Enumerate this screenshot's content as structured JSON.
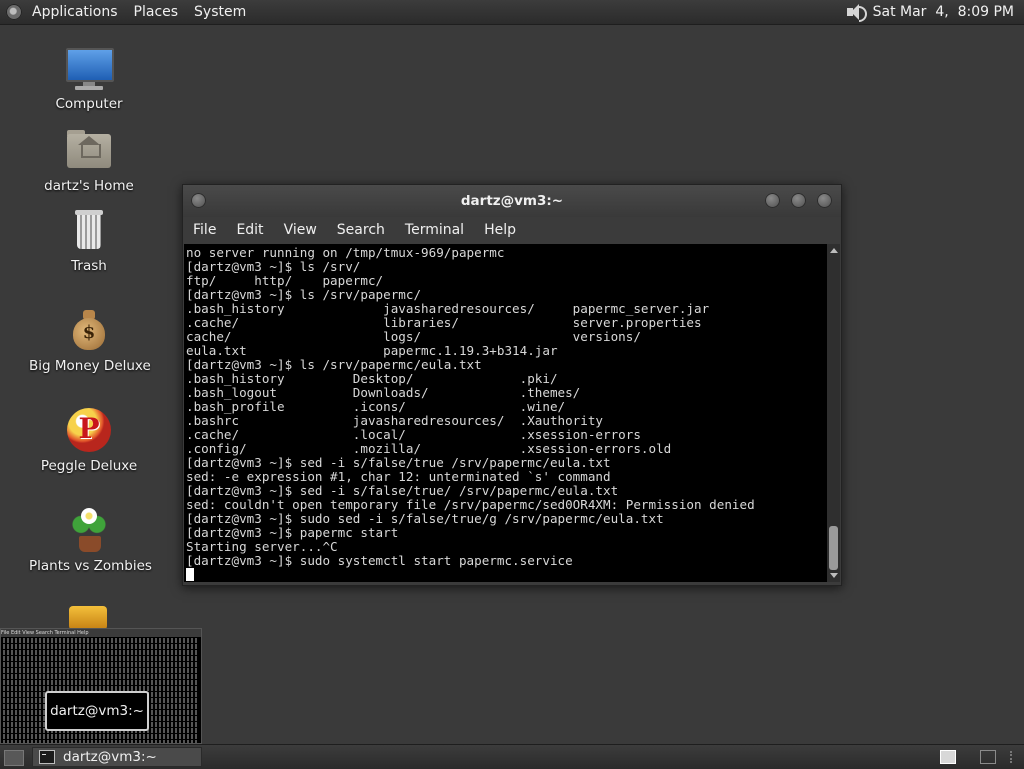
{
  "top_panel": {
    "menus": [
      "Applications",
      "Places",
      "System"
    ],
    "clock": "Sat Mar  4,  8:09 PM"
  },
  "desktop_icons": [
    {
      "label": "Computer",
      "icon": "computer-icon"
    },
    {
      "label": "dartz's Home",
      "icon": "home-folder-icon"
    },
    {
      "label": "Trash",
      "icon": "trash-icon"
    },
    {
      "label": "Big Money Deluxe",
      "icon": "money-bag-icon"
    },
    {
      "label": "Peggle Deluxe",
      "icon": "peggle-icon"
    },
    {
      "label": "Plants vs Zombies",
      "icon": "plants-vs-zombies-icon"
    }
  ],
  "terminal": {
    "title": "dartz@vm3:~",
    "menu": [
      "File",
      "Edit",
      "View",
      "Search",
      "Terminal",
      "Help"
    ],
    "lines": [
      "no server running on /tmp/tmux-969/papermc",
      "[dartz@vm3 ~]$ ls /srv/",
      "ftp/     http/    papermc/",
      "[dartz@vm3 ~]$ ls /srv/papermc/",
      ".bash_history             javasharedresources/     papermc_server.jar",
      ".cache/                   libraries/               server.properties",
      "cache/                    logs/                    versions/",
      "eula.txt                  papermc.1.19.3+b314.jar",
      "[dartz@vm3 ~]$ ls /srv/papermc/eula.txt",
      ".bash_history         Desktop/              .pki/",
      ".bash_logout          Downloads/            .themes/",
      ".bash_profile         .icons/               .wine/",
      ".bashrc               javasharedresources/  .Xauthority",
      ".cache/               .local/               .xsession-errors",
      ".config/              .mozilla/             .xsession-errors.old",
      "[dartz@vm3 ~]$ sed -i s/false/true /srv/papermc/eula.txt",
      "sed: -e expression #1, char 12: unterminated `s' command",
      "[dartz@vm3 ~]$ sed -i s/false/true/ /srv/papermc/eula.txt",
      "sed: couldn't open temporary file /srv/papermc/sed0OR4XM: Permission denied",
      "[dartz@vm3 ~]$ sudo sed -i s/false/true/g /srv/papermc/eula.txt",
      "[dartz@vm3 ~]$ papermc start",
      "Starting server...^C",
      "[dartz@vm3 ~]$ sudo systemctl start papermc.service"
    ]
  },
  "preview": {
    "menu": "File   Edit   View   Search   Terminal   Help",
    "tooltip": "dartz@vm3:~"
  },
  "bottom_panel": {
    "task_label": "dartz@vm3:~"
  }
}
